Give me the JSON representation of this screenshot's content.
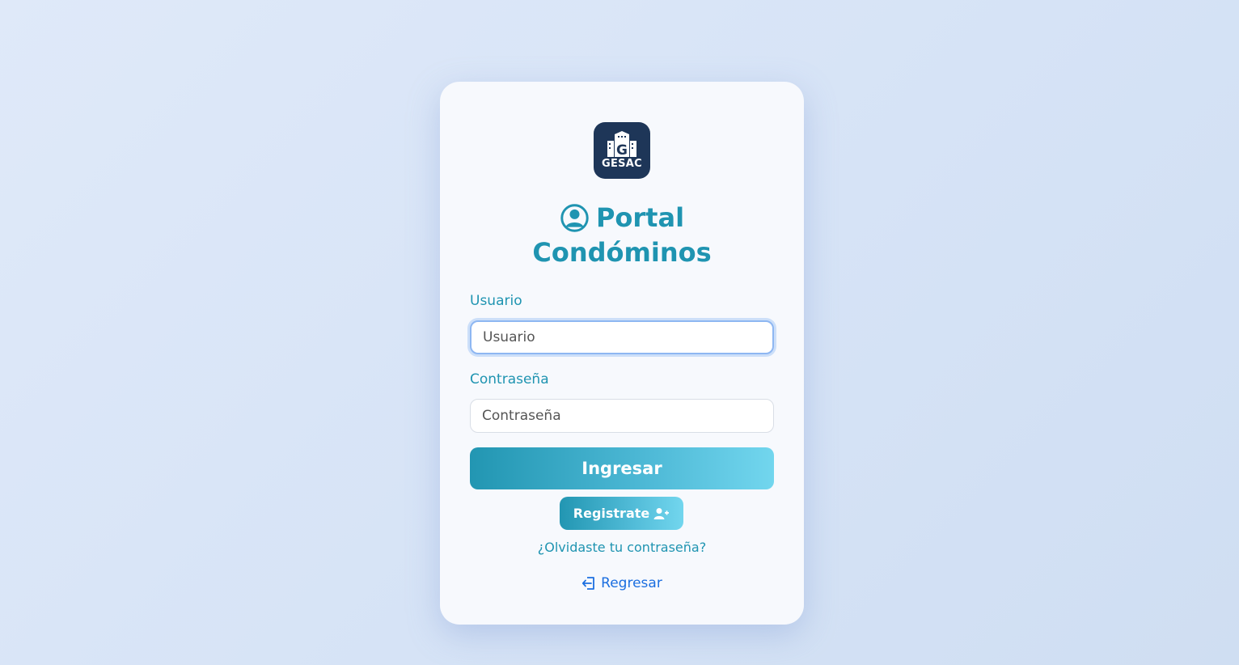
{
  "logo": {
    "text": "GESAC",
    "icon": "building-icon"
  },
  "header": {
    "title_line1": "Portal",
    "title_line2": "Condóminos",
    "icon": "user-circle-icon"
  },
  "form": {
    "username": {
      "label": "Usuario",
      "placeholder": "Usuario",
      "value": ""
    },
    "password": {
      "label": "Contraseña",
      "placeholder": "Contraseña",
      "value": ""
    },
    "submit_label": "Ingresar",
    "register_label": "Registrate",
    "register_icon": "user-plus-icon",
    "forgot_label": "¿Olvidaste tu contraseña?",
    "back_label": "Regresar",
    "back_icon": "sign-in-icon"
  },
  "colors": {
    "accent": "#1f94b1",
    "logo_bg": "#1e3658",
    "link_blue": "#1c6fe0",
    "gradient_start": "#2296b2",
    "gradient_end": "#72d6ee"
  }
}
